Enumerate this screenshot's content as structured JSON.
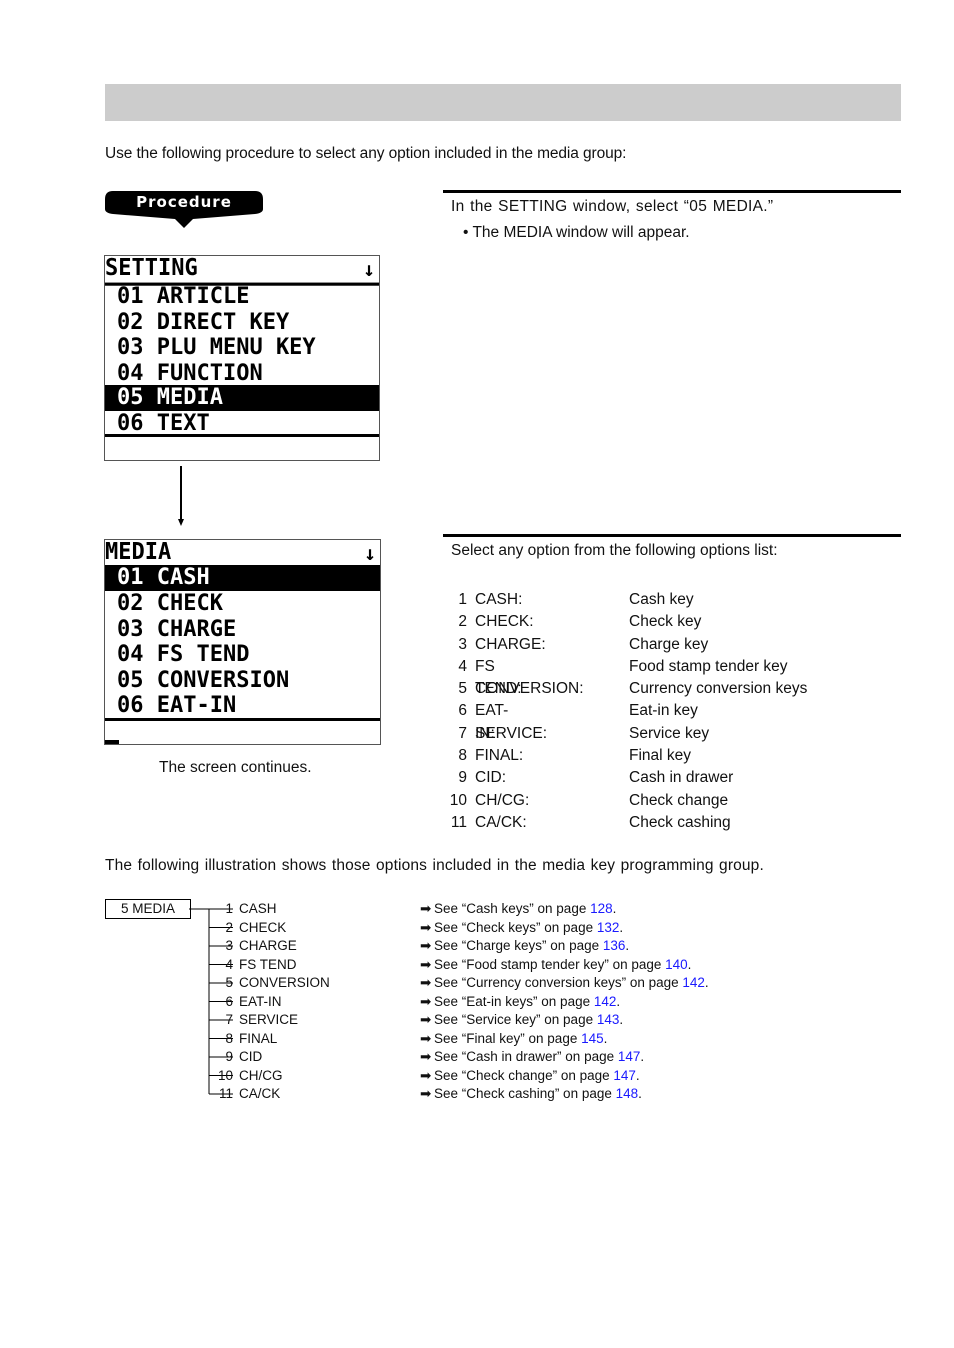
{
  "header": {
    "title": ""
  },
  "intro": "Use the following procedure to select any option included in the media group:",
  "procedure_badge": "Procedure",
  "steps": [
    {
      "text": "In the SETTING window, select “05 MEDIA.”",
      "bullet": "• The MEDIA window will appear."
    },
    {
      "text": "Select any option from the following options list:"
    }
  ],
  "setting_screen": {
    "title": "SETTING",
    "scroll_icon": "↓",
    "rows": [
      "01 ARTICLE",
      "02 DIRECT KEY",
      "03 PLU MENU KEY",
      "04 FUNCTION",
      "05 MEDIA",
      "06 TEXT"
    ],
    "selected_index": 4
  },
  "media_screen": {
    "title": "MEDIA",
    "scroll_icon": "↓",
    "rows": [
      "01 CASH",
      "02 CHECK",
      "03 CHARGE",
      "04 FS TEND",
      "05 CONVERSION",
      "06 EAT-IN"
    ],
    "selected_index": 0,
    "caption": "The screen continues."
  },
  "options": [
    {
      "num": "1",
      "key": "CASH:",
      "desc": "Cash key"
    },
    {
      "num": "2",
      "key": "CHECK:",
      "desc": "Check key"
    },
    {
      "num": "3",
      "key": "CHARGE:",
      "desc": "Charge key"
    },
    {
      "num": "4",
      "key": "FS TEND:",
      "desc": "Food stamp tender key"
    },
    {
      "num": "5",
      "key": "CONVERSION:",
      "desc": "Currency conversion keys"
    },
    {
      "num": "6",
      "key": "EAT-IN:",
      "desc": "Eat-in key"
    },
    {
      "num": "7",
      "key": "SERVICE:",
      "desc": "Service key"
    },
    {
      "num": "8",
      "key": "FINAL:",
      "desc": "Final key"
    },
    {
      "num": "9",
      "key": "CID:",
      "desc": "Cash in drawer"
    },
    {
      "num": "10",
      "key": "CH/CG:",
      "desc": "Check change"
    },
    {
      "num": "11",
      "key": "CA/CK:",
      "desc": "Check cashing"
    }
  ],
  "illustration_intro": "The following illustration shows those options included in the media key programming group.",
  "tree": {
    "root": "5 MEDIA",
    "items": [
      {
        "num": "1",
        "label": "CASH",
        "ref_pre": "See “Cash keys” on page ",
        "page": "128"
      },
      {
        "num": "2",
        "label": "CHECK",
        "ref_pre": "See “Check keys” on page ",
        "page": "132"
      },
      {
        "num": "3",
        "label": "CHARGE",
        "ref_pre": "See “Charge keys” on page ",
        "page": "136"
      },
      {
        "num": "4",
        "label": "FS TEND",
        "ref_pre": "See “Food stamp tender key” on page ",
        "page": "140"
      },
      {
        "num": "5",
        "label": "CONVERSION",
        "ref_pre": "See “Currency conversion keys” on page ",
        "page": "142"
      },
      {
        "num": "6",
        "label": "EAT-IN",
        "ref_pre": "See “Eat-in keys” on page ",
        "page": "142"
      },
      {
        "num": "7",
        "label": "SERVICE",
        "ref_pre": "See “Service key” on page ",
        "page": "143"
      },
      {
        "num": "8",
        "label": "FINAL",
        "ref_pre": "See “Final key” on page ",
        "page": "145"
      },
      {
        "num": "9",
        "label": "CID",
        "ref_pre": "See “Cash in drawer” on page ",
        "page": "147"
      },
      {
        "num": "10",
        "label": "CH/CG",
        "ref_pre": "See “Check change” on page ",
        "page": "147"
      },
      {
        "num": "11",
        "label": "CA/CK",
        "ref_pre": "See “Check cashing” on page ",
        "page": "148"
      }
    ],
    "ref_arrow_icon": "➡",
    "ref_suffix": "."
  },
  "colors": {
    "header_bar": "#cccccc",
    "link": "#1a1aff"
  }
}
